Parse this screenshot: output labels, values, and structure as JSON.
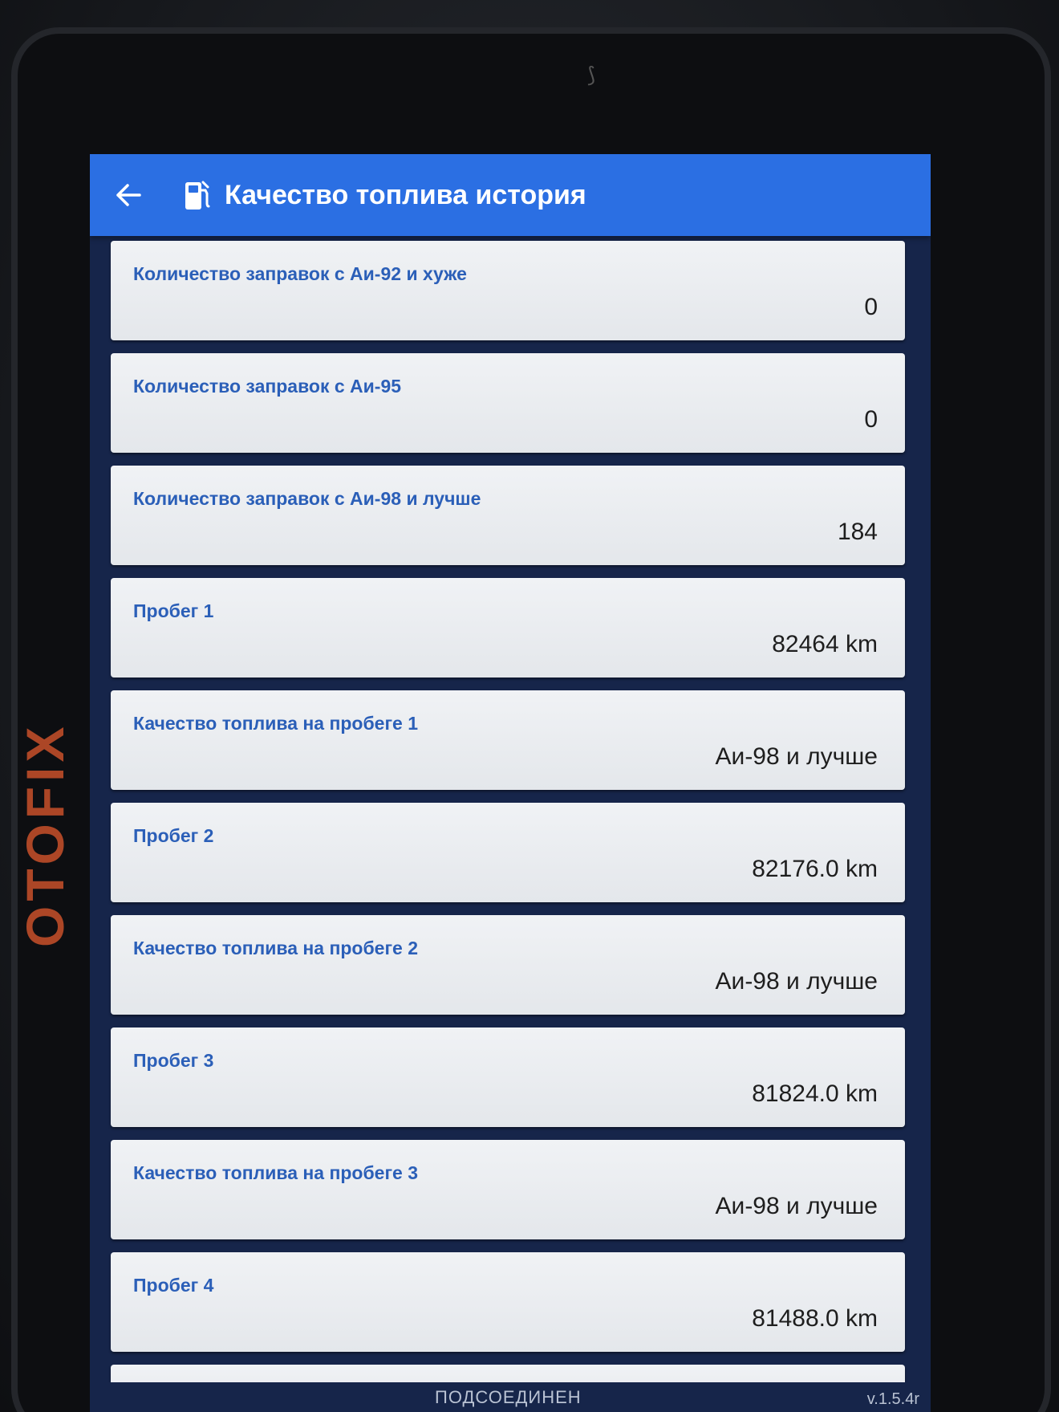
{
  "device": {
    "brand": "OTOFIX"
  },
  "header": {
    "back_icon": "arrow-left-icon",
    "title_icon": "fuel-pump-icon",
    "title": "Качество топлива история",
    "color": "#2b6fe3"
  },
  "items": [
    {
      "label": "Количество заправок с Аи-92 и хуже",
      "value": "0"
    },
    {
      "label": "Количество заправок с Аи-95",
      "value": "0"
    },
    {
      "label": "Количество заправок с Аи-98 и лучше",
      "value": "184"
    },
    {
      "label": "Пробег 1",
      "value": "82464 km"
    },
    {
      "label": "Качество топлива на пробеге 1",
      "value": "Аи-98 и лучше"
    },
    {
      "label": "Пробег 2",
      "value": "82176.0 km"
    },
    {
      "label": "Качество топлива на пробеге 2",
      "value": "Аи-98 и лучше"
    },
    {
      "label": "Пробег 3",
      "value": "81824.0 km"
    },
    {
      "label": "Качество топлива на пробеге 3",
      "value": "Аи-98 и лучше"
    },
    {
      "label": "Пробег 4",
      "value": "81488.0 km"
    }
  ],
  "status": {
    "connection": "ПОДСОЕДИНЕН",
    "version": "v.1.5.4r"
  },
  "colors": {
    "label_text": "#2b5fb8",
    "screen_background": "#16254a",
    "card_background": "#eceef1"
  }
}
